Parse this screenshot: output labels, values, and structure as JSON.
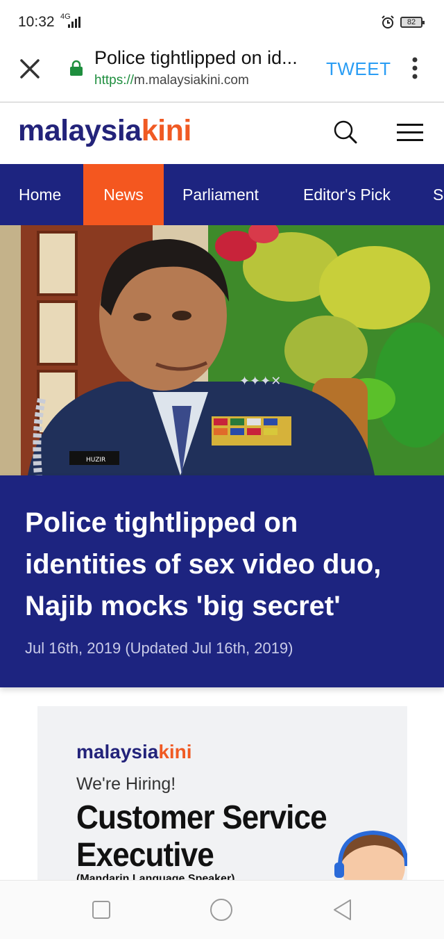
{
  "status_bar": {
    "time": "10:32",
    "network": "4G",
    "battery": "82",
    "icons": [
      "signal-icon",
      "alarm-icon",
      "battery-icon"
    ]
  },
  "toolbar": {
    "page_title": "Police tightlipped on id...",
    "url_scheme": "https://",
    "url_host": "m.malaysiakini.com",
    "tweet_label": "TWEET",
    "icons": [
      "close-icon",
      "lock-icon",
      "more-vert-icon"
    ],
    "lock_color": "#1e8e3e",
    "tweet_color": "#2a9df4"
  },
  "header": {
    "logo_part1": "malaysia",
    "logo_part2": "kini",
    "icons": [
      "search-icon",
      "hamburger-menu-icon"
    ],
    "brand_navy": "#23237a",
    "brand_orange": "#f05a23"
  },
  "nav": {
    "items": [
      {
        "label": "Home",
        "active": false
      },
      {
        "label": "News",
        "active": true
      },
      {
        "label": "Parliament",
        "active": false
      },
      {
        "label": "Editor's Pick",
        "active": false
      },
      {
        "label": "S",
        "active": false
      }
    ],
    "background": "#1d2480",
    "active_color": "#f4571f"
  },
  "article": {
    "headline": "Police tightlipped on identities of sex video duo, Najib mocks 'big secret'",
    "date": "Jul 16th, 2019 (Updated Jul 16th, 2019)",
    "name_tag": "HUZIR"
  },
  "ad": {
    "logo_part1": "malaysia",
    "logo_part2": "kini",
    "hiring": "We're Hiring!",
    "role_line1": "Customer Service",
    "role_line2": "Executive",
    "sub": "(Mandarin Language Speaker)"
  },
  "system_nav": {
    "icons": [
      "recents-square-icon",
      "home-circle-icon",
      "back-triangle-icon"
    ]
  }
}
